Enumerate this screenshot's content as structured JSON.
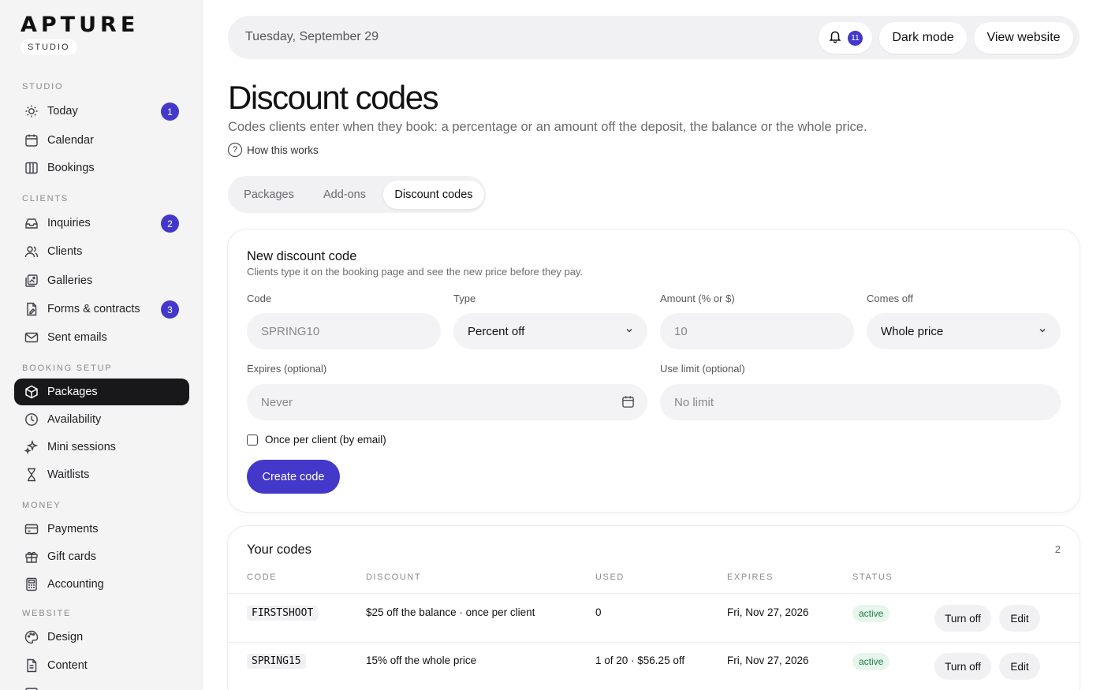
{
  "brand": {
    "name": "APTURE",
    "badge": "STUDIO"
  },
  "sidebar": {
    "sections": [
      {
        "title": "STUDIO"
      },
      {
        "title": "CLIENTS"
      },
      {
        "title": "BOOKING SETUP"
      },
      {
        "title": "MONEY"
      },
      {
        "title": "WEBSITE"
      }
    ],
    "items": [
      {
        "label": "Today",
        "icon": "sun-icon",
        "badge": "1"
      },
      {
        "label": "Calendar",
        "icon": "calendar-icon"
      },
      {
        "label": "Bookings",
        "icon": "columns-icon"
      },
      {
        "label": "Inquiries",
        "icon": "inbox-icon",
        "badge": "2"
      },
      {
        "label": "Clients",
        "icon": "users-icon"
      },
      {
        "label": "Galleries",
        "icon": "gallery-icon"
      },
      {
        "label": "Forms & contracts",
        "icon": "document-icon",
        "badge": "3"
      },
      {
        "label": "Sent emails",
        "icon": "mail-icon"
      },
      {
        "label": "Packages",
        "icon": "package-icon",
        "active": true
      },
      {
        "label": "Availability",
        "icon": "clock-icon"
      },
      {
        "label": "Mini sessions",
        "icon": "sparkle-icon"
      },
      {
        "label": "Waitlists",
        "icon": "hourglass-icon"
      },
      {
        "label": "Payments",
        "icon": "card-icon"
      },
      {
        "label": "Gift cards",
        "icon": "gift-icon"
      },
      {
        "label": "Accounting",
        "icon": "calculator-icon"
      },
      {
        "label": "Design",
        "icon": "palette-icon"
      },
      {
        "label": "Content",
        "icon": "page-icon"
      }
    ]
  },
  "topbar": {
    "date": "Tuesday, September 29",
    "notifications": "11",
    "dark_mode": "Dark mode",
    "view_website": "View website"
  },
  "page": {
    "title": "Discount codes",
    "subtitle": "Codes clients enter when they book: a percentage or an amount off the deposit, the balance or the whole price.",
    "help": "How this works"
  },
  "tabs": [
    "Packages",
    "Add-ons",
    "Discount codes"
  ],
  "form": {
    "title": "New discount code",
    "subtitle": "Clients type it on the booking page and see the new price before they pay.",
    "code_label": "Code",
    "code_placeholder": "SPRING10",
    "type_label": "Type",
    "type_value": "Percent off",
    "amount_label": "Amount (% or $)",
    "amount_placeholder": "10",
    "comes_off_label": "Comes off",
    "comes_off_value": "Whole price",
    "expires_label": "Expires (optional)",
    "expires_placeholder": "Never",
    "limit_label": "Use limit (optional)",
    "limit_placeholder": "No limit",
    "once_per_client": "Once per client (by email)",
    "create_button": "Create code"
  },
  "codes": {
    "title": "Your codes",
    "count": "2",
    "headers": [
      "CODE",
      "DISCOUNT",
      "USED",
      "EXPIRES",
      "STATUS"
    ],
    "rows": [
      {
        "code": "FIRSTSHOOT",
        "discount": "$25 off the balance · once per client",
        "used": "0",
        "expires": "Fri, Nov 27, 2026",
        "status": "active",
        "turn_off": "Turn off",
        "edit": "Edit"
      },
      {
        "code": "SPRING15",
        "discount": "15% off the whole price",
        "used": "1 of 20 · $56.25 off",
        "expires": "Fri, Nov 27, 2026",
        "status": "active",
        "turn_off": "Turn off",
        "edit": "Edit"
      }
    ]
  },
  "colors": {
    "accent": "#4338ca",
    "sidebar_bg": "#f4f4f5",
    "active_nav": "#18181b",
    "status_green": "#1e7a44"
  }
}
